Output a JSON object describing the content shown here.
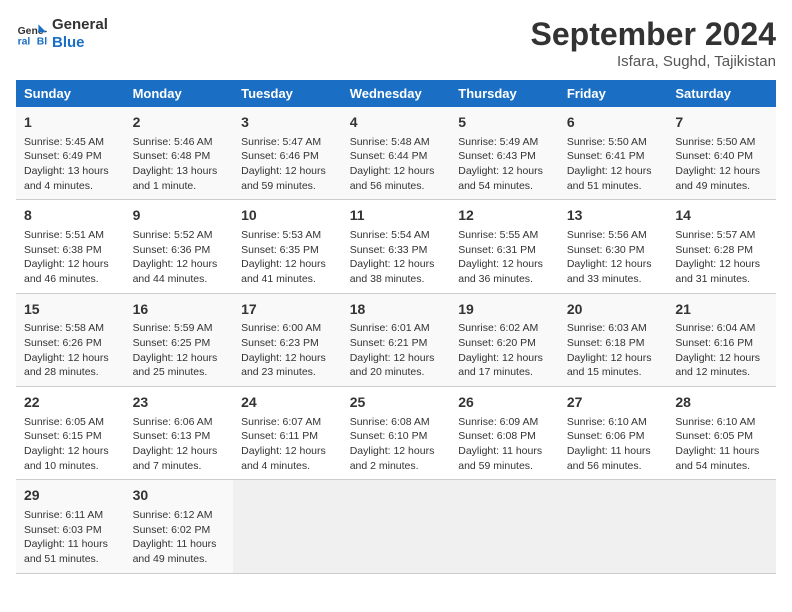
{
  "header": {
    "logo_line1": "General",
    "logo_line2": "Blue",
    "month": "September 2024",
    "location": "Isfara, Sughd, Tajikistan"
  },
  "days_of_week": [
    "Sunday",
    "Monday",
    "Tuesday",
    "Wednesday",
    "Thursday",
    "Friday",
    "Saturday"
  ],
  "weeks": [
    [
      {
        "day": "1",
        "info": "Sunrise: 5:45 AM\nSunset: 6:49 PM\nDaylight: 13 hours\nand 4 minutes."
      },
      {
        "day": "2",
        "info": "Sunrise: 5:46 AM\nSunset: 6:48 PM\nDaylight: 13 hours\nand 1 minute."
      },
      {
        "day": "3",
        "info": "Sunrise: 5:47 AM\nSunset: 6:46 PM\nDaylight: 12 hours\nand 59 minutes."
      },
      {
        "day": "4",
        "info": "Sunrise: 5:48 AM\nSunset: 6:44 PM\nDaylight: 12 hours\nand 56 minutes."
      },
      {
        "day": "5",
        "info": "Sunrise: 5:49 AM\nSunset: 6:43 PM\nDaylight: 12 hours\nand 54 minutes."
      },
      {
        "day": "6",
        "info": "Sunrise: 5:50 AM\nSunset: 6:41 PM\nDaylight: 12 hours\nand 51 minutes."
      },
      {
        "day": "7",
        "info": "Sunrise: 5:50 AM\nSunset: 6:40 PM\nDaylight: 12 hours\nand 49 minutes."
      }
    ],
    [
      {
        "day": "8",
        "info": "Sunrise: 5:51 AM\nSunset: 6:38 PM\nDaylight: 12 hours\nand 46 minutes."
      },
      {
        "day": "9",
        "info": "Sunrise: 5:52 AM\nSunset: 6:36 PM\nDaylight: 12 hours\nand 44 minutes."
      },
      {
        "day": "10",
        "info": "Sunrise: 5:53 AM\nSunset: 6:35 PM\nDaylight: 12 hours\nand 41 minutes."
      },
      {
        "day": "11",
        "info": "Sunrise: 5:54 AM\nSunset: 6:33 PM\nDaylight: 12 hours\nand 38 minutes."
      },
      {
        "day": "12",
        "info": "Sunrise: 5:55 AM\nSunset: 6:31 PM\nDaylight: 12 hours\nand 36 minutes."
      },
      {
        "day": "13",
        "info": "Sunrise: 5:56 AM\nSunset: 6:30 PM\nDaylight: 12 hours\nand 33 minutes."
      },
      {
        "day": "14",
        "info": "Sunrise: 5:57 AM\nSunset: 6:28 PM\nDaylight: 12 hours\nand 31 minutes."
      }
    ],
    [
      {
        "day": "15",
        "info": "Sunrise: 5:58 AM\nSunset: 6:26 PM\nDaylight: 12 hours\nand 28 minutes."
      },
      {
        "day": "16",
        "info": "Sunrise: 5:59 AM\nSunset: 6:25 PM\nDaylight: 12 hours\nand 25 minutes."
      },
      {
        "day": "17",
        "info": "Sunrise: 6:00 AM\nSunset: 6:23 PM\nDaylight: 12 hours\nand 23 minutes."
      },
      {
        "day": "18",
        "info": "Sunrise: 6:01 AM\nSunset: 6:21 PM\nDaylight: 12 hours\nand 20 minutes."
      },
      {
        "day": "19",
        "info": "Sunrise: 6:02 AM\nSunset: 6:20 PM\nDaylight: 12 hours\nand 17 minutes."
      },
      {
        "day": "20",
        "info": "Sunrise: 6:03 AM\nSunset: 6:18 PM\nDaylight: 12 hours\nand 15 minutes."
      },
      {
        "day": "21",
        "info": "Sunrise: 6:04 AM\nSunset: 6:16 PM\nDaylight: 12 hours\nand 12 minutes."
      }
    ],
    [
      {
        "day": "22",
        "info": "Sunrise: 6:05 AM\nSunset: 6:15 PM\nDaylight: 12 hours\nand 10 minutes."
      },
      {
        "day": "23",
        "info": "Sunrise: 6:06 AM\nSunset: 6:13 PM\nDaylight: 12 hours\nand 7 minutes."
      },
      {
        "day": "24",
        "info": "Sunrise: 6:07 AM\nSunset: 6:11 PM\nDaylight: 12 hours\nand 4 minutes."
      },
      {
        "day": "25",
        "info": "Sunrise: 6:08 AM\nSunset: 6:10 PM\nDaylight: 12 hours\nand 2 minutes."
      },
      {
        "day": "26",
        "info": "Sunrise: 6:09 AM\nSunset: 6:08 PM\nDaylight: 11 hours\nand 59 minutes."
      },
      {
        "day": "27",
        "info": "Sunrise: 6:10 AM\nSunset: 6:06 PM\nDaylight: 11 hours\nand 56 minutes."
      },
      {
        "day": "28",
        "info": "Sunrise: 6:10 AM\nSunset: 6:05 PM\nDaylight: 11 hours\nand 54 minutes."
      }
    ],
    [
      {
        "day": "29",
        "info": "Sunrise: 6:11 AM\nSunset: 6:03 PM\nDaylight: 11 hours\nand 51 minutes."
      },
      {
        "day": "30",
        "info": "Sunrise: 6:12 AM\nSunset: 6:02 PM\nDaylight: 11 hours\nand 49 minutes."
      },
      {
        "day": "",
        "info": ""
      },
      {
        "day": "",
        "info": ""
      },
      {
        "day": "",
        "info": ""
      },
      {
        "day": "",
        "info": ""
      },
      {
        "day": "",
        "info": ""
      }
    ]
  ]
}
